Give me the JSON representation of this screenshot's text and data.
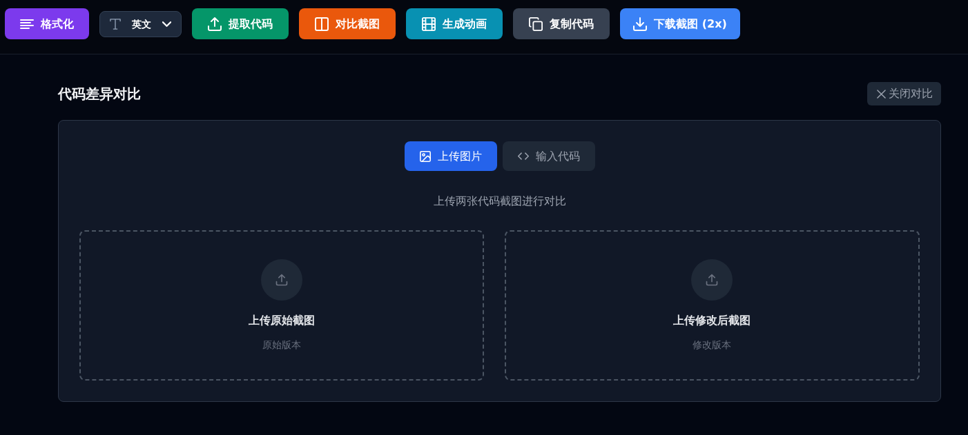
{
  "toolbar": {
    "items": [
      {
        "kind": "button",
        "label": "格式化",
        "color": "#7c3aed"
      },
      {
        "kind": "select",
        "value": "英文"
      },
      {
        "kind": "button",
        "label": "提取代码",
        "color": "#059669"
      },
      {
        "kind": "button",
        "label": "对比截图",
        "color": "#ea580c"
      },
      {
        "kind": "button",
        "label": "生成动画",
        "color": "#0891b2"
      },
      {
        "kind": "button",
        "label": "复制代码",
        "color": "#374151"
      },
      {
        "kind": "button",
        "label": "下载截图 (2x)",
        "color": "#3b82f6"
      }
    ]
  },
  "panel": {
    "title": "代码差异对比",
    "close_button": "关闭对比",
    "tabs": [
      {
        "label": "上传图片",
        "selected": true
      },
      {
        "label": "输入代码",
        "selected": false
      }
    ],
    "hint": "上传两张代码截图进行对比",
    "dropzones": [
      {
        "title": "上传原始截图",
        "subtitle": "原始版本"
      },
      {
        "title": "上传修改后截图",
        "subtitle": "修改版本"
      }
    ]
  }
}
